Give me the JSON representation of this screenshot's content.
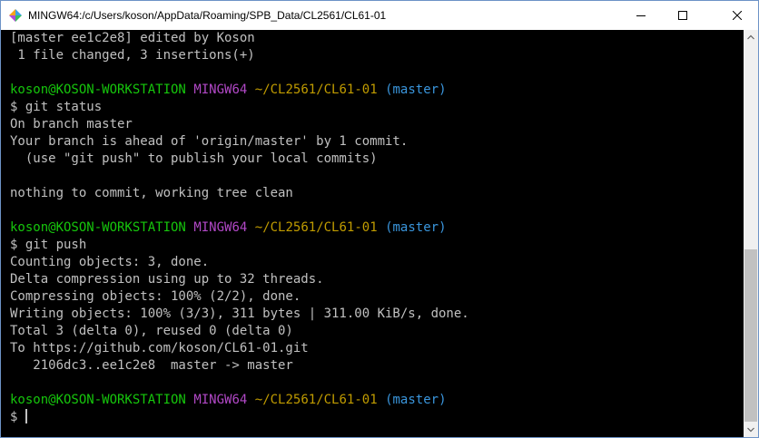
{
  "window": {
    "title": "MINGW64:/c/Users/koson/AppData/Roaming/SPB_Data/CL2561/CL61-01",
    "icon": "mingw-diamond-icon"
  },
  "colors": {
    "background": "#000000",
    "text": "#c0c0c0",
    "prompt_user": "#16c60c",
    "prompt_env": "#b148c6",
    "prompt_path": "#c19c00",
    "prompt_branch": "#3a96dd"
  },
  "terminal": {
    "lines": [
      [
        {
          "t": "[master ee1c2e8] edited by Koson",
          "c": "default"
        }
      ],
      [
        {
          "t": " 1 file changed, 3 insertions(+)",
          "c": "default"
        }
      ],
      [],
      [
        {
          "t": "koson@KOSON-WORKSTATION",
          "c": "green"
        },
        {
          "t": " ",
          "c": "default"
        },
        {
          "t": "MINGW64",
          "c": "magenta"
        },
        {
          "t": " ",
          "c": "default"
        },
        {
          "t": "~/CL2561/CL61-01",
          "c": "yellow"
        },
        {
          "t": " ",
          "c": "default"
        },
        {
          "t": "(master)",
          "c": "cyan"
        }
      ],
      [
        {
          "t": "$ git status",
          "c": "default"
        }
      ],
      [
        {
          "t": "On branch master",
          "c": "default"
        }
      ],
      [
        {
          "t": "Your branch is ahead of 'origin/master' by 1 commit.",
          "c": "default"
        }
      ],
      [
        {
          "t": "  (use \"git push\" to publish your local commits)",
          "c": "default"
        }
      ],
      [],
      [
        {
          "t": "nothing to commit, working tree clean",
          "c": "default"
        }
      ],
      [],
      [
        {
          "t": "koson@KOSON-WORKSTATION",
          "c": "green"
        },
        {
          "t": " ",
          "c": "default"
        },
        {
          "t": "MINGW64",
          "c": "magenta"
        },
        {
          "t": " ",
          "c": "default"
        },
        {
          "t": "~/CL2561/CL61-01",
          "c": "yellow"
        },
        {
          "t": " ",
          "c": "default"
        },
        {
          "t": "(master)",
          "c": "cyan"
        }
      ],
      [
        {
          "t": "$ git push",
          "c": "default"
        }
      ],
      [
        {
          "t": "Counting objects: 3, done.",
          "c": "default"
        }
      ],
      [
        {
          "t": "Delta compression using up to 32 threads.",
          "c": "default"
        }
      ],
      [
        {
          "t": "Compressing objects: 100% (2/2), done.",
          "c": "default"
        }
      ],
      [
        {
          "t": "Writing objects: 100% (3/3), 311 bytes | 311.00 KiB/s, done.",
          "c": "default"
        }
      ],
      [
        {
          "t": "Total 3 (delta 0), reused 0 (delta 0)",
          "c": "default"
        }
      ],
      [
        {
          "t": "To https://github.com/koson/CL61-01.git",
          "c": "default"
        }
      ],
      [
        {
          "t": "   2106dc3..ee1c2e8  master -> master",
          "c": "default"
        }
      ],
      [],
      [
        {
          "t": "koson@KOSON-WORKSTATION",
          "c": "green"
        },
        {
          "t": " ",
          "c": "default"
        },
        {
          "t": "MINGW64",
          "c": "magenta"
        },
        {
          "t": " ",
          "c": "default"
        },
        {
          "t": "~/CL2561/CL61-01",
          "c": "yellow"
        },
        {
          "t": " ",
          "c": "default"
        },
        {
          "t": "(master)",
          "c": "cyan"
        }
      ],
      [
        {
          "t": "$ ",
          "c": "default"
        }
      ]
    ]
  },
  "icons": {
    "minimize": "minimize-icon",
    "maximize": "maximize-icon",
    "close": "close-icon",
    "scroll_up": "chevron-up-icon",
    "scroll_down": "chevron-down-icon"
  }
}
